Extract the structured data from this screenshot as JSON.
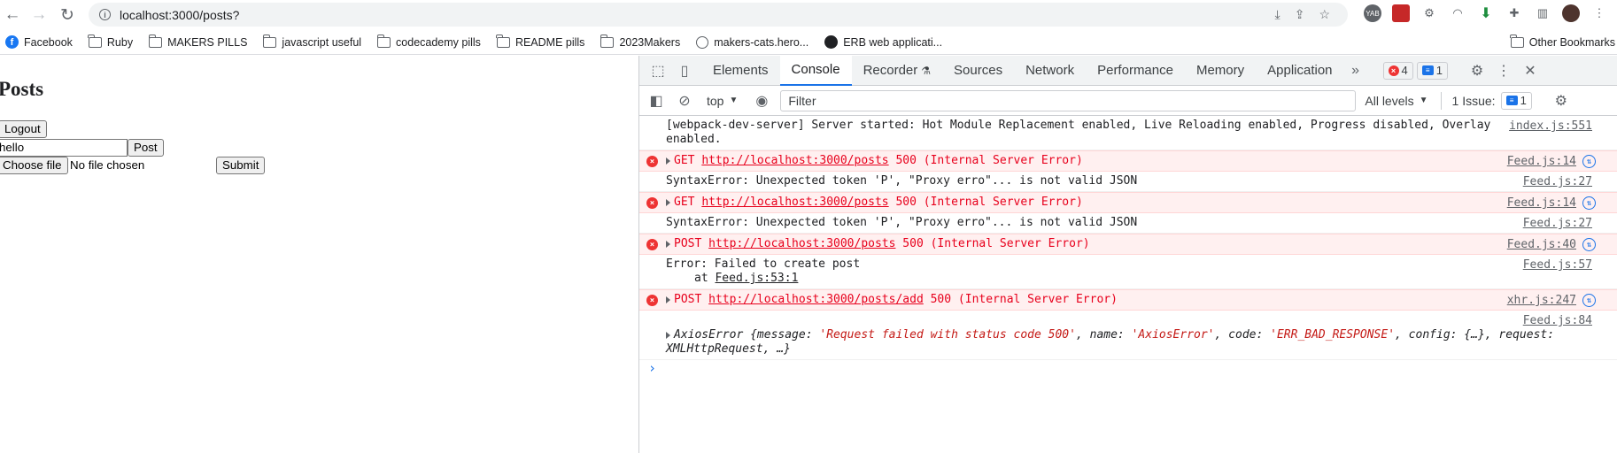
{
  "browser": {
    "url": "localhost:3000/posts?",
    "bookmarks": [
      {
        "label": "Facebook",
        "icon": "facebook-icon"
      },
      {
        "label": "Ruby",
        "icon": "folder-icon"
      },
      {
        "label": "MAKERS PILLS",
        "icon": "folder-icon"
      },
      {
        "label": "javascript useful",
        "icon": "folder-icon"
      },
      {
        "label": "codecademy pills",
        "icon": "folder-icon"
      },
      {
        "label": "README pills",
        "icon": "folder-icon"
      },
      {
        "label": "2023Makers",
        "icon": "folder-icon"
      },
      {
        "label": "makers-cats.hero...",
        "icon": "globe-icon"
      },
      {
        "label": "ERB web applicati...",
        "icon": "github-icon"
      }
    ],
    "other_bookmarks": "Other Bookmarks"
  },
  "page": {
    "title": "Posts",
    "logout_label": "Logout",
    "post_input_value": "hello",
    "post_label": "Post",
    "choose_file_label": "Choose file",
    "no_file_label": "No file chosen",
    "submit_label": "Submit"
  },
  "devtools": {
    "tabs": [
      "Elements",
      "Console",
      "Recorder",
      "Sources",
      "Network",
      "Performance",
      "Memory",
      "Application"
    ],
    "active_tab": "Console",
    "error_count": "4",
    "info_count": "1",
    "context": "top",
    "filter_placeholder": "Filter",
    "levels": "All levels",
    "issues_label": "1 Issue:",
    "issues_count": "1",
    "messages": [
      {
        "text": "[webpack-dev-server] Server started: Hot Module Replacement enabled, Live Reloading enabled, Progress disabled, Overlay enabled.",
        "source": "index.js:551"
      },
      {
        "method": "GET",
        "url": "http://localhost:3000/posts",
        "status": "500 (Internal Server Error)",
        "source": "Feed.js:14"
      },
      {
        "text": "SyntaxError: Unexpected token 'P', \"Proxy erro\"... is not valid JSON",
        "source": "Feed.js:27"
      },
      {
        "method": "GET",
        "url": "http://localhost:3000/posts",
        "status": "500 (Internal Server Error)",
        "source": "Feed.js:14"
      },
      {
        "text": "SyntaxError: Unexpected token 'P', \"Proxy erro\"... is not valid JSON",
        "source": "Feed.js:27"
      },
      {
        "method": "POST",
        "url": "http://localhost:3000/posts",
        "status": "500 (Internal Server Error)",
        "source": "Feed.js:40"
      },
      {
        "text": "Error: Failed to create post",
        "trace": "at",
        "trace_link": "Feed.js:53:1",
        "source": "Feed.js:57"
      },
      {
        "method": "POST",
        "url": "http://localhost:3000/posts/add",
        "status": "500 (Internal Server Error)",
        "source": "xhr.js:247"
      },
      {
        "source": "Feed.js:84",
        "axios_prefix": "AxiosError {message: ",
        "axios_message": "'Request failed with status code 500'",
        "axios_name_key": ", name: ",
        "axios_name": "'AxiosError'",
        "axios_code_key": ", code: ",
        "axios_code": "'ERR_BAD_RESPONSE'",
        "axios_rest": ", config: {…}, request: XMLHttpRequest, …}"
      }
    ]
  }
}
